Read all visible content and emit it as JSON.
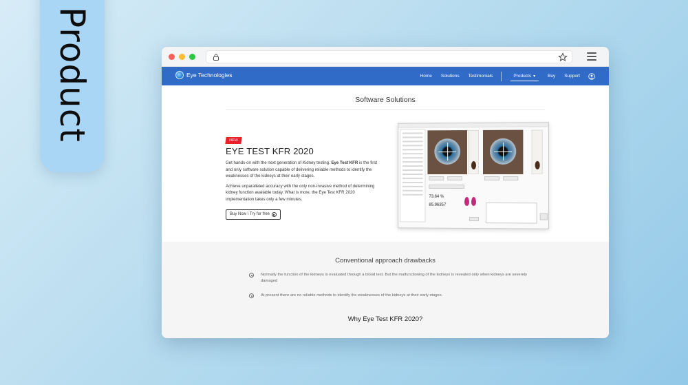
{
  "tag": {
    "label": "Product"
  },
  "navbar": {
    "brand": "Eye Technologies",
    "links": [
      "Home",
      "Solutions",
      "Testimonials"
    ],
    "products_label": "Products",
    "buy_label": "Buy",
    "support_label": "Support"
  },
  "main": {
    "section_title": "Software Solutions",
    "badge": "NEW",
    "product_title": "EYE TEST KFR 2020",
    "para1_a": "Get hands-on with the next generation of Kidney testing. ",
    "para1_b": "Eye Test KFR",
    "para1_c": " is the first and only software solution capable of delivering reliable methods to identify the weaknesses of the kidneys at their early stages.",
    "para2": "Achieve unparalleled accuracy with the only non-invasive method of determining kidney function available today. What is more, the Eye Test KFR 2020 implementation takes only a few minutes.",
    "cta": "Buy Now \\ Try for free"
  },
  "app_mock": {
    "value1": "73.64 %",
    "value2": "85.96357"
  },
  "drawbacks": {
    "title": "Conventional approach drawbacks",
    "items": [
      "Normally the function of the kidneys is evaluated through a blood test. But the malfunctioning of the kidneys is revealed only when kidneys are severely damaged",
      "At present there are no reliable methods to identify the weaknesses of the kidneys at their early stages."
    ]
  },
  "why": {
    "title": "Why Eye Test KFR 2020?"
  },
  "colors": {
    "nav": "#2f6bc7",
    "badge": "#e8202a",
    "tag": "#a9d6f5"
  }
}
